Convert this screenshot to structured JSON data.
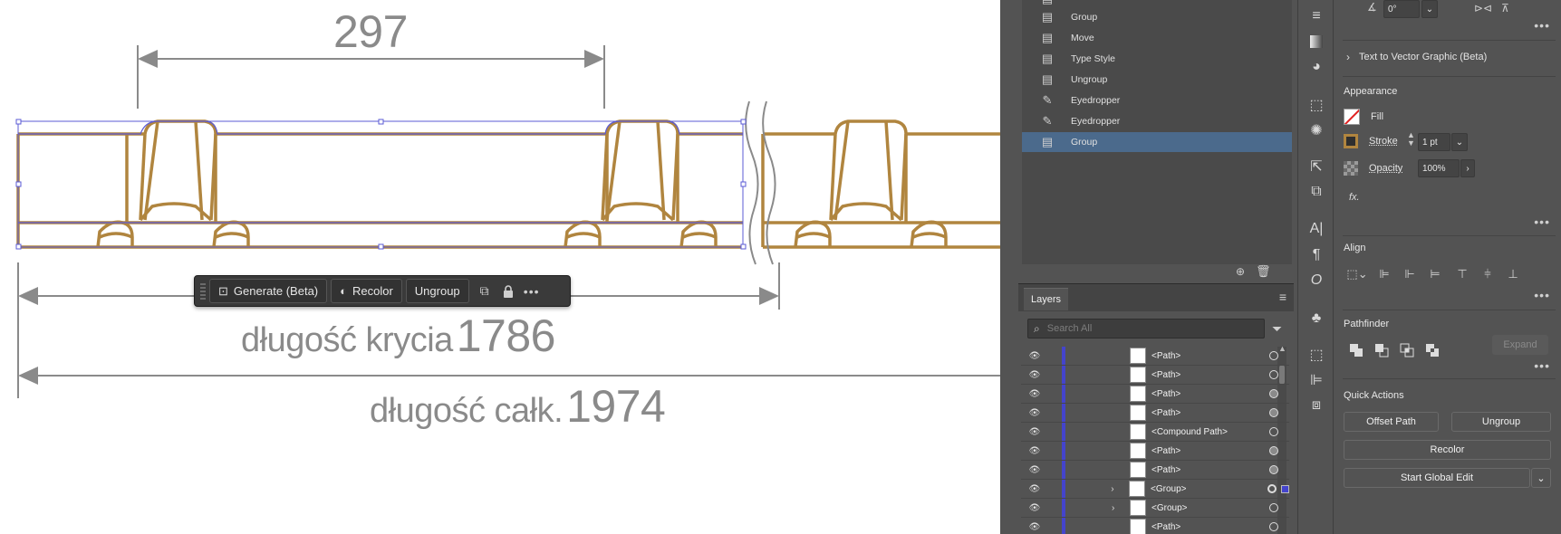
{
  "canvas": {
    "dim_top": "297",
    "dim_cover_label": "długość krycia",
    "dim_cover_value": "1786",
    "dim_total_label": "długość całk.",
    "dim_total_value": "1974"
  },
  "context_bar": {
    "generate_label": "Generate (Beta)",
    "recolor_label": "Recolor",
    "ungroup_label": "Ungroup"
  },
  "history": {
    "items": [
      {
        "label": "Group",
        "icon": "document-icon"
      },
      {
        "label": "Move",
        "icon": "document-icon"
      },
      {
        "label": "Type Style",
        "icon": "document-icon"
      },
      {
        "label": "Ungroup",
        "icon": "document-icon"
      },
      {
        "label": "Eyedropper",
        "icon": "eyedropper-icon"
      },
      {
        "label": "Eyedropper",
        "icon": "eyedropper-icon"
      },
      {
        "label": "Group",
        "icon": "document-icon",
        "selected": true
      }
    ]
  },
  "layers": {
    "tab_label": "Layers",
    "search_placeholder": "Search All",
    "rows": [
      {
        "name": "<Path>",
        "target": "empty"
      },
      {
        "name": "<Path>",
        "target": "empty"
      },
      {
        "name": "<Path>",
        "target": "filled"
      },
      {
        "name": "<Path>",
        "target": "filled"
      },
      {
        "name": "<Compound Path>",
        "target": "empty"
      },
      {
        "name": "<Path>",
        "target": "filled"
      },
      {
        "name": "<Path>",
        "target": "filled"
      },
      {
        "name": "<Group>",
        "target": "double",
        "expandable": true,
        "selected_square": true
      },
      {
        "name": "<Group>",
        "target": "empty",
        "expandable": true
      },
      {
        "name": "<Path>",
        "target": "empty"
      }
    ]
  },
  "properties": {
    "angle_value": "0°",
    "text_to_vector": "Text to Vector Graphic (Beta)",
    "appearance_title": "Appearance",
    "fill_label": "Fill",
    "stroke_label": "Stroke",
    "stroke_value": "1 pt",
    "opacity_label": "Opacity",
    "opacity_value": "100%",
    "fx_label": "fx.",
    "align_title": "Align",
    "pathfinder_title": "Pathfinder",
    "expand_label": "Expand",
    "quick_actions_title": "Quick Actions",
    "offset_path_label": "Offset Path",
    "ungroup_label": "Ungroup",
    "recolor_label": "Recolor",
    "global_edit_label": "Start Global Edit"
  },
  "colors": {
    "tile_stroke": "#b0853f",
    "selection": "#5b5bd6",
    "dimension": "#8a8a8a",
    "history_selected": "#4b6a8c",
    "panel_bg": "#535353"
  }
}
